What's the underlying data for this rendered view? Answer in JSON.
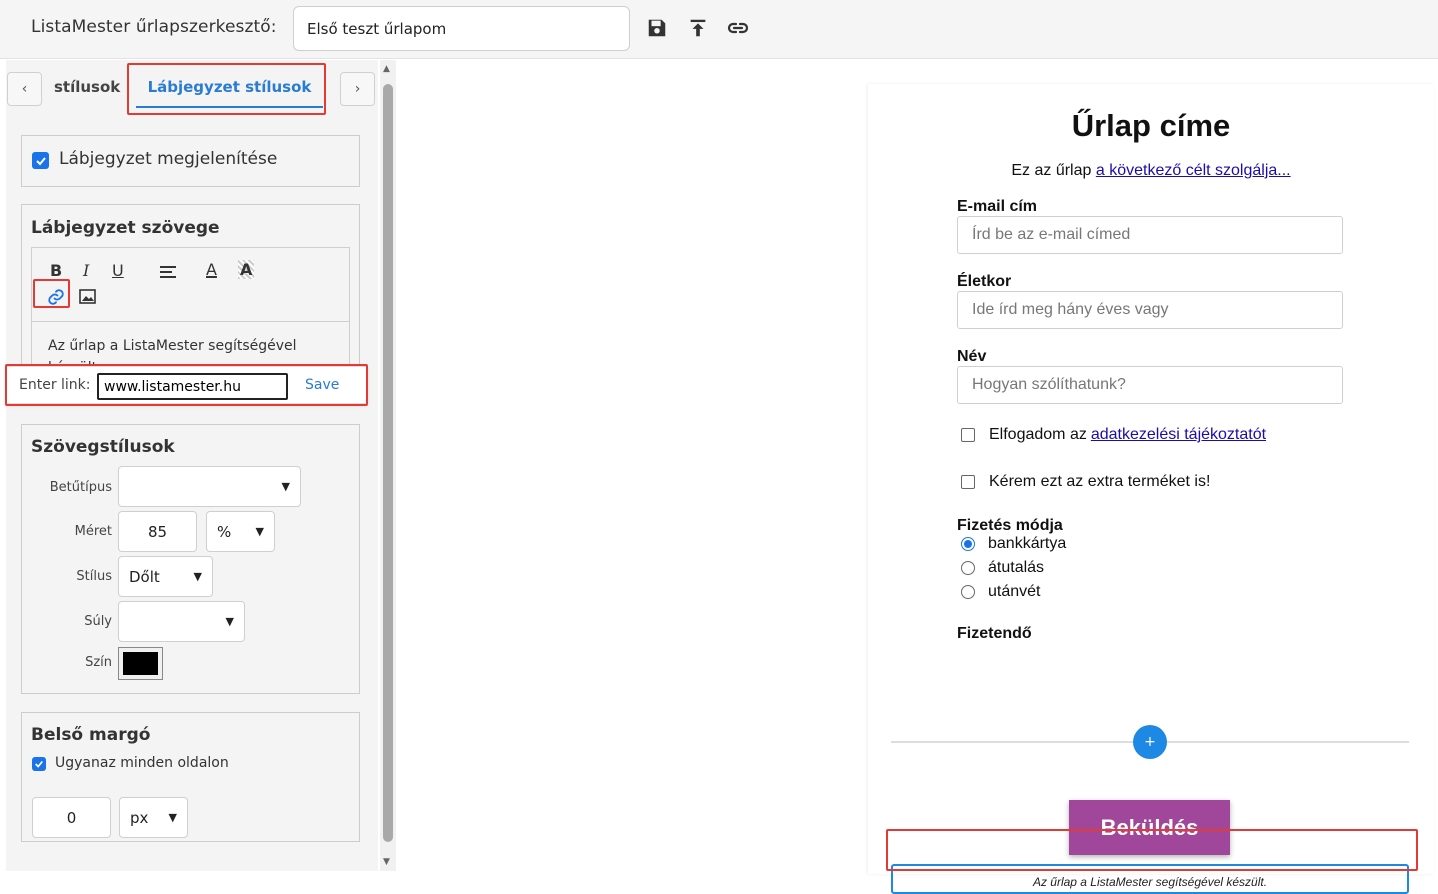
{
  "app": {
    "title": "ListaMester űrlapszerkesztő:",
    "form_name": "Első teszt űrlapom"
  },
  "toolbar": {
    "icons": [
      "save-icon",
      "upload-icon",
      "link-icon"
    ]
  },
  "panel": {
    "prev_arrow": "‹",
    "next_arrow": "›",
    "tab_styles": "stílusok",
    "tab_footer": "Lábjegyzet stílusok",
    "show_footer_label": "Lábjegyzet megjelenítése",
    "show_footer_checked": true,
    "footer_text_title": "Lábjegyzet szövege",
    "editor_buttons": {
      "bold": "B",
      "italic": "I",
      "underline": "U",
      "color": "A",
      "highlight": "A"
    },
    "editor_text": "Az űrlap a ListaMester segítségével készült.",
    "link_popup": {
      "label": "Enter link:",
      "value": "www.listamester.hu",
      "save": "Save"
    },
    "text_styles_title": "Szövegstílusok",
    "font_label": "Betűtípus",
    "font_value": "",
    "size_label": "Méret",
    "size_value": "85",
    "size_unit": "%",
    "style_label": "Stílus",
    "style_value": "Dőlt",
    "weight_label": "Súly",
    "weight_value": "",
    "color_label": "Szín",
    "color_value": "#000000",
    "padding_title": "Belső margó",
    "same_all_sides_label": "Ugyanaz minden oldalon",
    "same_all_sides_checked": true,
    "padding_value": "0",
    "padding_unit": "px"
  },
  "form": {
    "title": "Űrlap címe",
    "desc_prefix": "Ez az űrlap",
    "desc_link": "a következő célt szolgálja...",
    "email_label": "E-mail cím",
    "email_placeholder": "Írd be az e-mail címed",
    "age_label": "Életkor",
    "age_placeholder": "Ide írd meg hány éves vagy",
    "name_label": "Név",
    "name_placeholder": "Hogyan szólíthatunk?",
    "privacy_prefix": "Elfogadom az",
    "privacy_link": "adatkezelési tájékoztatót",
    "extra_label": "Kérem ezt az extra terméket is!",
    "payment_label": "Fizetés módja",
    "payment_options": [
      "bankkártya",
      "átutalás",
      "utánvét"
    ],
    "payment_selected": "bankkártya",
    "payer_label": "Fizetendő",
    "add_button": "+",
    "submit": "Beküldés",
    "footer_note": "Az űrlap a ListaMester segítségével készült."
  },
  "colors": {
    "accent": "#2a7bd3",
    "highlight_border": "#e53935",
    "submit_bg": "#a0479c",
    "add_button_bg": "#1e88e5"
  }
}
